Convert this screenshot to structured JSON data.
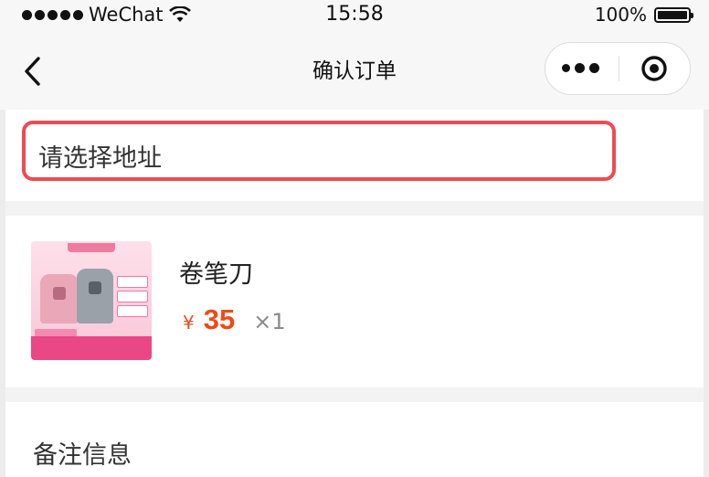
{
  "status_bar": {
    "carrier": "WeChat",
    "time": "15:58",
    "battery_percent": "100%"
  },
  "nav": {
    "title": "确认订单"
  },
  "address": {
    "placeholder": "请选择地址",
    "highlight_color": "#ef4b52"
  },
  "product": {
    "name": "卷笔刀",
    "currency": "¥",
    "price": "35",
    "quantity": "×1",
    "price_color": "#f04a16"
  },
  "remark": {
    "label": "备注信息"
  },
  "icons": {
    "back": "chevron-left-icon",
    "more": "more-dots-icon",
    "close": "target-circle-icon",
    "wifi": "wifi-icon",
    "battery": "battery-icon"
  }
}
